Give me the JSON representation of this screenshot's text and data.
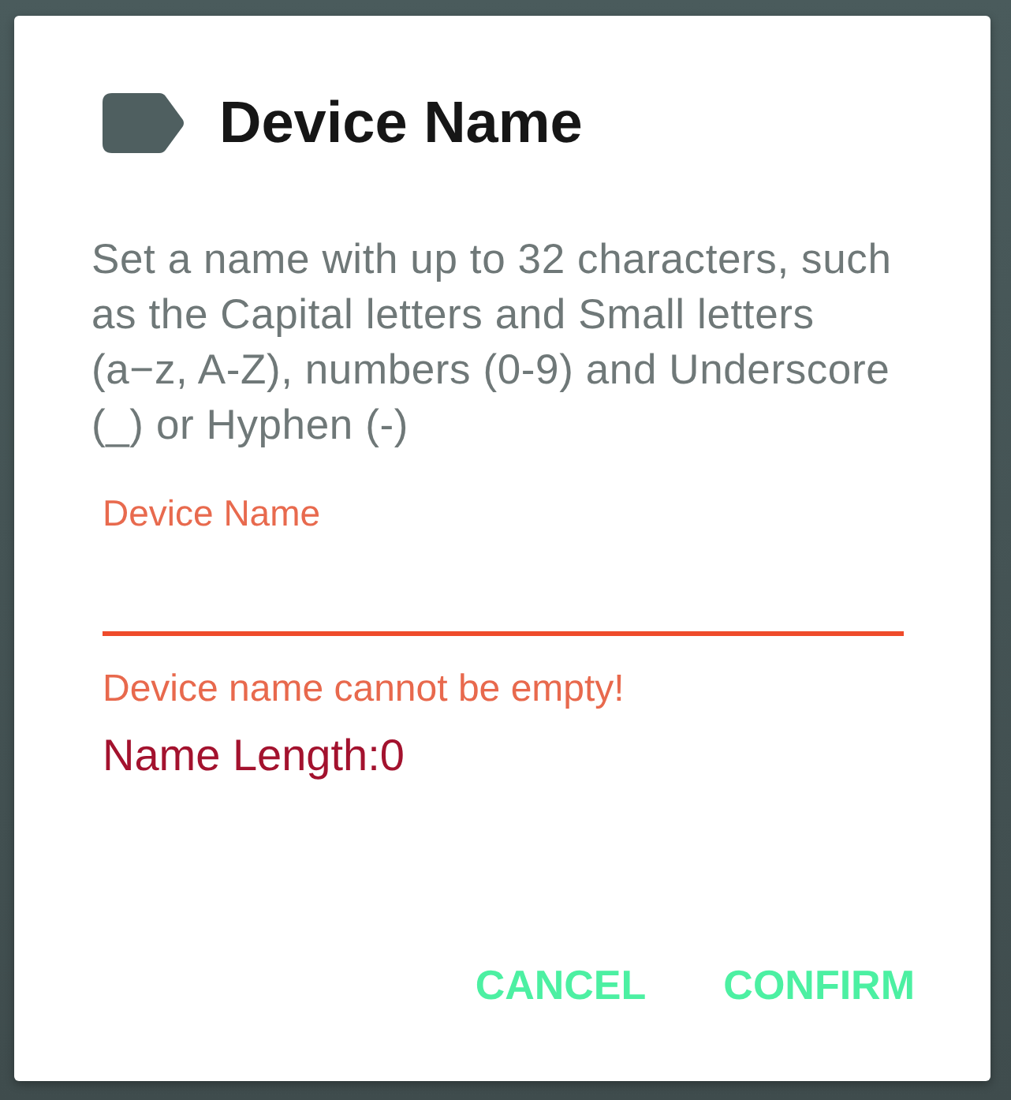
{
  "dialog": {
    "title": "Device Name",
    "description": "Set a name with up to 32 characters, such as the Capital letters and Small letters (a−z, A-Z), numbers (0-9) and Underscore (_) or Hyphen (-)",
    "field": {
      "label": "Device Name",
      "error": true,
      "error_text": "Device name cannot be empty!"
    },
    "name_length": "Name Length:0",
    "buttons": [
      "CANCEL",
      "CONFIRM"
    ]
  }
}
